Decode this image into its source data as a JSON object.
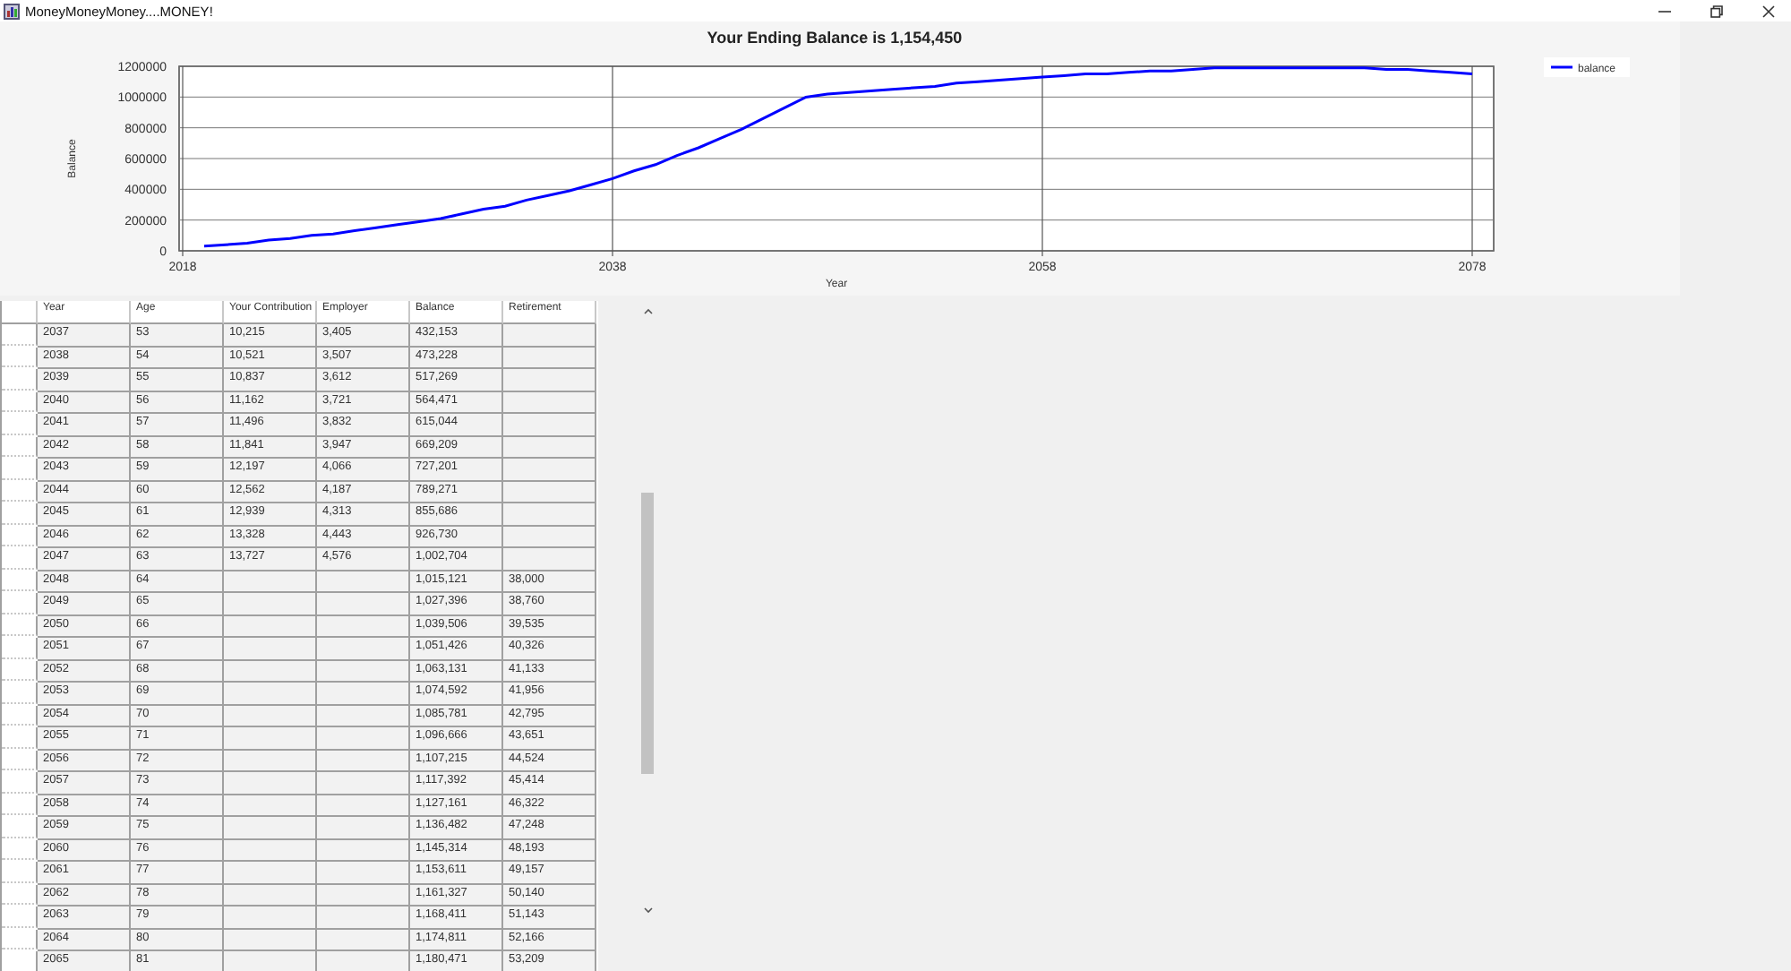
{
  "window": {
    "title": "MoneyMoneyMoney....MONEY!"
  },
  "chart": {
    "chart_data": {
      "type": "line",
      "title": "Your Ending Balance is 1,154,450",
      "xlabel": "Year",
      "ylabel": "Balance",
      "xlim": [
        2018,
        2079
      ],
      "ylim": [
        0,
        1200000
      ],
      "grid": true,
      "xticks": [
        {
          "value": 2018,
          "label": "2018"
        },
        {
          "value": 2038,
          "label": "2038"
        },
        {
          "value": 2058,
          "label": "2058"
        },
        {
          "value": 2078,
          "label": "2078"
        }
      ],
      "yticks": [
        0,
        200000,
        400000,
        600000,
        800000,
        1000000,
        1200000
      ],
      "x": [
        2019,
        2020,
        2021,
        2022,
        2023,
        2024,
        2025,
        2026,
        2027,
        2028,
        2029,
        2030,
        2031,
        2032,
        2033,
        2034,
        2035,
        2036,
        2037,
        2038,
        2039,
        2040,
        2041,
        2042,
        2043,
        2044,
        2045,
        2046,
        2047,
        2048,
        2049,
        2050,
        2051,
        2052,
        2053,
        2054,
        2055,
        2056,
        2057,
        2058,
        2059,
        2060,
        2061,
        2062,
        2063,
        2064,
        2065,
        2066,
        2067,
        2068,
        2069,
        2070,
        2071,
        2072,
        2073,
        2074,
        2075,
        2076,
        2077,
        2078
      ],
      "series": [
        {
          "name": "balance",
          "color": "#0000ff",
          "values": [
            30000,
            40000,
            50000,
            70000,
            80000,
            100000,
            110000,
            130000,
            150000,
            170000,
            190000,
            210000,
            240000,
            270000,
            290000,
            330000,
            360000,
            390000,
            430000,
            470000,
            520000,
            560000,
            620000,
            670000,
            730000,
            790000,
            860000,
            930000,
            1000000,
            1020000,
            1030000,
            1040000,
            1050000,
            1060000,
            1070000,
            1090000,
            1100000,
            1110000,
            1120000,
            1130000,
            1140000,
            1150000,
            1150000,
            1160000,
            1170000,
            1170000,
            1180000,
            1190000,
            1190000,
            1190000,
            1190000,
            1190000,
            1190000,
            1190000,
            1190000,
            1180000,
            1180000,
            1170000,
            1160000,
            1150000
          ]
        }
      ]
    }
  },
  "table": {
    "columns": [
      "Year",
      "Age",
      "Your Contribution",
      "Employer",
      "Balance",
      "Retirement"
    ],
    "rows": [
      {
        "kind": "saving",
        "cells": [
          "2037",
          "53",
          "10,215",
          "3,405",
          "432,153"
        ]
      },
      {
        "kind": "saving",
        "cells": [
          "2038",
          "54",
          "10,521",
          "3,507",
          "473,228"
        ]
      },
      {
        "kind": "saving",
        "cells": [
          "2039",
          "55",
          "10,837",
          "3,612",
          "517,269"
        ]
      },
      {
        "kind": "saving",
        "cells": [
          "2040",
          "56",
          "11,162",
          "3,721",
          "564,471"
        ]
      },
      {
        "kind": "saving",
        "cells": [
          "2041",
          "57",
          "11,496",
          "3,832",
          "615,044"
        ]
      },
      {
        "kind": "saving",
        "cells": [
          "2042",
          "58",
          "11,841",
          "3,947",
          "669,209"
        ]
      },
      {
        "kind": "saving",
        "cells": [
          "2043",
          "59",
          "12,197",
          "4,066",
          "727,201"
        ]
      },
      {
        "kind": "saving",
        "cells": [
          "2044",
          "60",
          "12,562",
          "4,187",
          "789,271"
        ]
      },
      {
        "kind": "saving",
        "cells": [
          "2045",
          "61",
          "12,939",
          "4,313",
          "855,686"
        ]
      },
      {
        "kind": "saving",
        "cells": [
          "2046",
          "62",
          "13,328",
          "4,443",
          "926,730"
        ]
      },
      {
        "kind": "saving",
        "cells": [
          "2047",
          "63",
          "13,727",
          "4,576",
          "1,002,704"
        ]
      },
      {
        "kind": "retired",
        "cells": [
          "2048",
          "64",
          "1,015,121",
          "38,000"
        ]
      },
      {
        "kind": "retired",
        "cells": [
          "2049",
          "65",
          "1,027,396",
          "38,760"
        ]
      },
      {
        "kind": "retired",
        "cells": [
          "2050",
          "66",
          "1,039,506",
          "39,535"
        ]
      },
      {
        "kind": "retired",
        "cells": [
          "2051",
          "67",
          "1,051,426",
          "40,326"
        ]
      },
      {
        "kind": "retired",
        "cells": [
          "2052",
          "68",
          "1,063,131",
          "41,133"
        ]
      },
      {
        "kind": "retired",
        "cells": [
          "2053",
          "69",
          "1,074,592",
          "41,956"
        ]
      },
      {
        "kind": "retired",
        "cells": [
          "2054",
          "70",
          "1,085,781",
          "42,795"
        ]
      },
      {
        "kind": "retired",
        "cells": [
          "2055",
          "71",
          "1,096,666",
          "43,651"
        ]
      },
      {
        "kind": "retired",
        "cells": [
          "2056",
          "72",
          "1,107,215",
          "44,524"
        ]
      },
      {
        "kind": "retired",
        "cells": [
          "2057",
          "73",
          "1,117,392",
          "45,414"
        ]
      },
      {
        "kind": "retired",
        "cells": [
          "2058",
          "74",
          "1,127,161",
          "46,322"
        ]
      },
      {
        "kind": "retired",
        "cells": [
          "2059",
          "75",
          "1,136,482",
          "47,248"
        ]
      },
      {
        "kind": "retired",
        "cells": [
          "2060",
          "76",
          "1,145,314",
          "48,193"
        ]
      },
      {
        "kind": "retired",
        "cells": [
          "2061",
          "77",
          "1,153,611",
          "49,157"
        ]
      },
      {
        "kind": "retired",
        "cells": [
          "2062",
          "78",
          "1,161,327",
          "50,140"
        ]
      },
      {
        "kind": "retired",
        "cells": [
          "2063",
          "79",
          "1,168,411",
          "51,143"
        ]
      },
      {
        "kind": "retired",
        "cells": [
          "2064",
          "80",
          "1,174,811",
          "52,166"
        ]
      },
      {
        "kind": "retired",
        "cells": [
          "2065",
          "81",
          "1,180,471",
          "53,209"
        ]
      }
    ]
  }
}
